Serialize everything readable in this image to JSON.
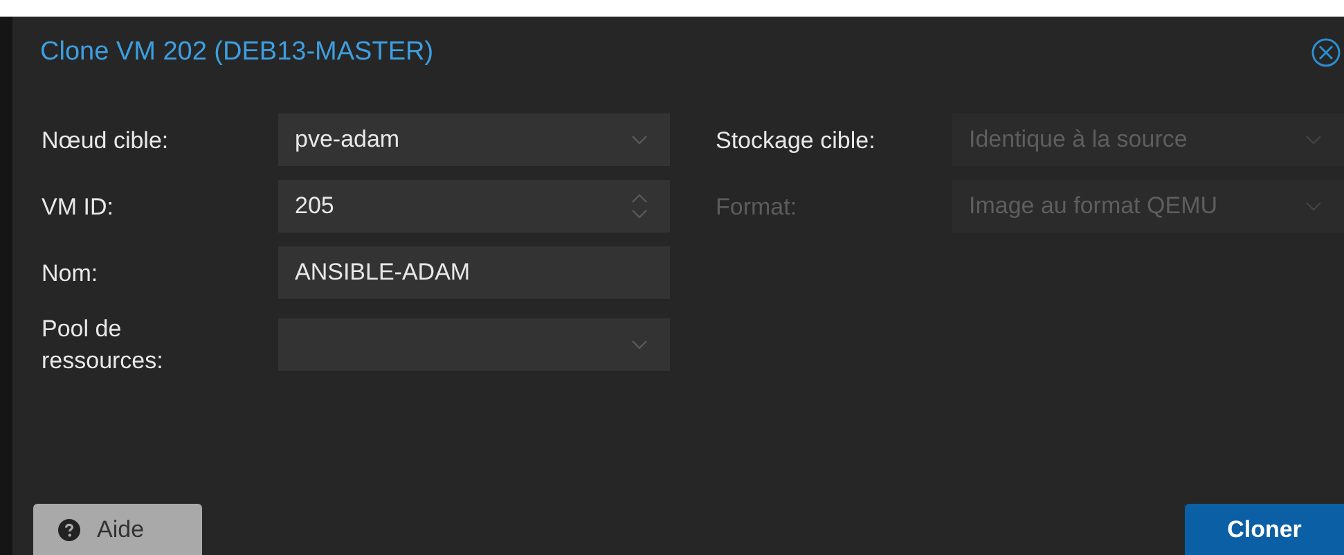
{
  "window": {
    "title": "Clone VM 202 (DEB13-MASTER)"
  },
  "left_fields": [
    {
      "label": "Nœud cible:",
      "kind": "select",
      "value": "pve-adam",
      "disabled": false
    },
    {
      "label": "VM ID:",
      "kind": "spinner",
      "value": "205",
      "disabled": false
    },
    {
      "label": "Nom:",
      "kind": "text",
      "value": "ANSIBLE-ADAM",
      "disabled": false
    },
    {
      "label": "Pool de ressources:",
      "kind": "select",
      "disabled": false
    }
  ],
  "right_fields": [
    {
      "label": "Stockage cible:",
      "label_disabled": false,
      "kind": "select",
      "placeholder": "Identique à la source",
      "disabled": true
    },
    {
      "label": "Format:",
      "label_disabled": true,
      "kind": "select",
      "value": "Image au format QEMU",
      "disabled": true
    }
  ],
  "buttons": [
    {
      "label": "Aide",
      "kind": "help"
    },
    {
      "label": "Cloner",
      "kind": "primary"
    }
  ]
}
